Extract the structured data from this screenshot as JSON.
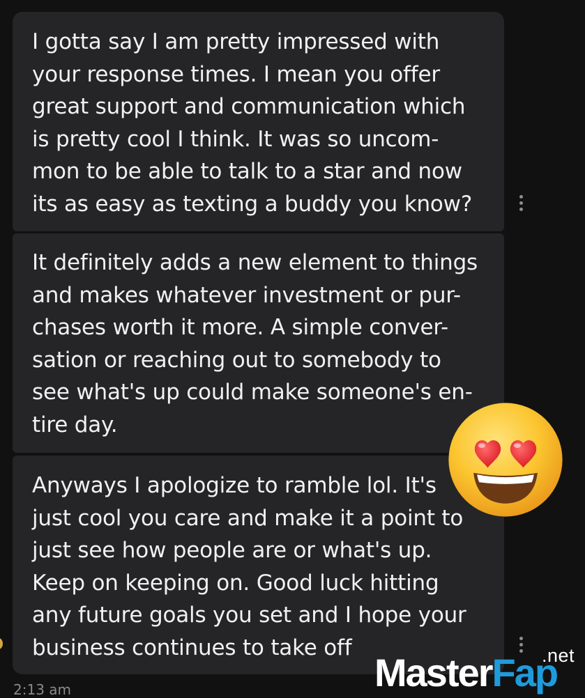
{
  "messages": [
    {
      "lines": [
        "I gotta say I am pretty impressed with",
        "your response times. I mean you offer",
        "great support and communication which",
        "is pretty cool I think. It was so uncom-",
        "mon to be able to talk to a star and now",
        "its as easy as texting a buddy you know?"
      ]
    },
    {
      "lines": [
        "It definitely adds a new element to things",
        "and makes whatever investment or pur-",
        "chases worth it more. A simple conver-",
        "sation or reaching out to somebody to",
        "see what's up could make someone's en-",
        "tire day."
      ]
    },
    {
      "lines": [
        "Anyways I apologize to ramble lol. It's",
        "just cool you care and make it a point to",
        "just see how people are or what's up.",
        "Keep on keeping on. Good luck hitting",
        "any future goals you set and I hope your",
        "business continues to take off"
      ]
    }
  ],
  "timestamp": "2:13 am",
  "reaction": {
    "icon": "heart-eyes-emoji"
  },
  "watermark": {
    "master": "Master",
    "fap": "Fap",
    "tld": ".net",
    "brand_color": "#1f9bdc"
  },
  "colors": {
    "background": "#111112",
    "bubble": "#252527",
    "text": "#f1f1f1",
    "muted": "#8a8a8e"
  }
}
